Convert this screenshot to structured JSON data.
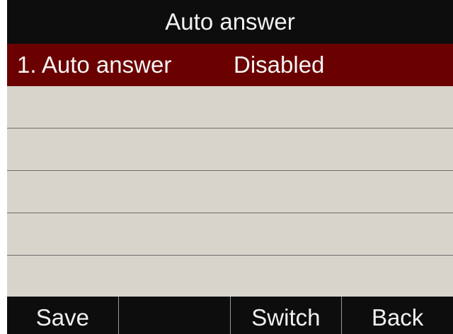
{
  "title": "Auto answer",
  "items": [
    {
      "label": "1. Auto answer",
      "value": "Disabled",
      "selected": true
    }
  ],
  "softkeys": [
    "Save",
    "",
    "Switch",
    "Back"
  ],
  "colors": {
    "title_bg": "#0d0d0d",
    "selected_row_bg": "#6b0000",
    "list_bg": "#d7d4cc",
    "softkey_bg": "#0d0d0d"
  }
}
